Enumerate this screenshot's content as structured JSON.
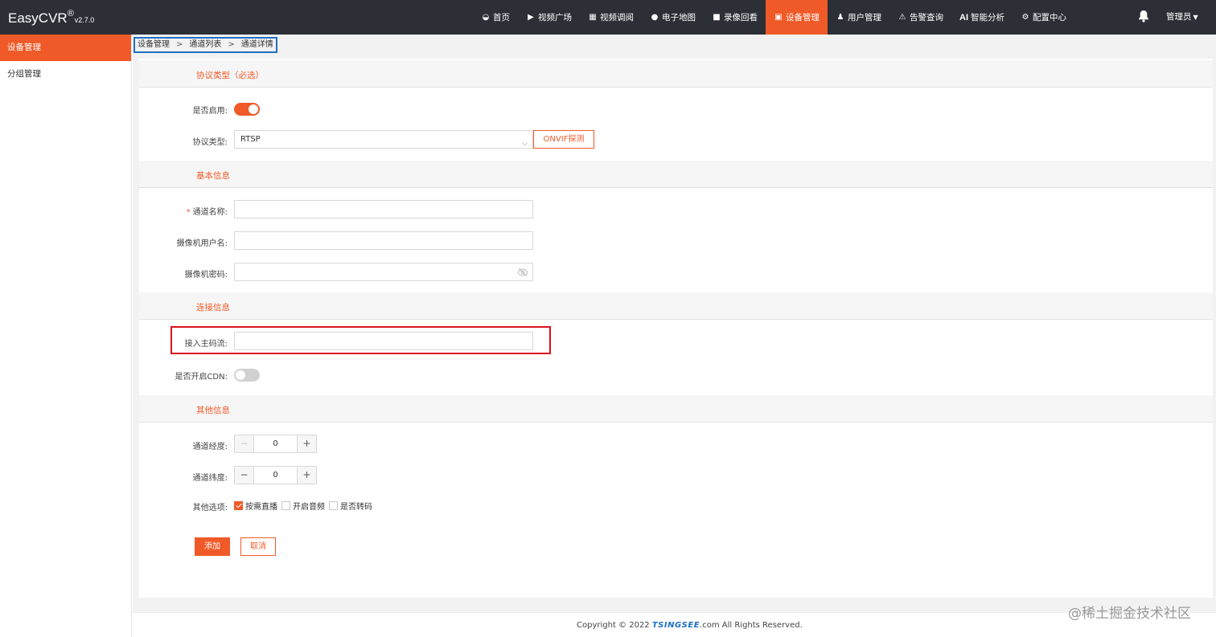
{
  "app": {
    "name": "EasyCVR",
    "reg": "®",
    "version": "v2.7.0"
  },
  "nav": [
    {
      "icon": "dashboard-icon",
      "glyph": "◒",
      "label": "首页"
    },
    {
      "icon": "play-icon",
      "glyph": "▶",
      "label": "视频广场"
    },
    {
      "icon": "grid-icon",
      "glyph": "▦",
      "label": "视频调阅"
    },
    {
      "icon": "map-pin-icon",
      "glyph": "●",
      "label": "电子地图"
    },
    {
      "icon": "video-camera-icon",
      "glyph": "■",
      "label": "录像回看"
    },
    {
      "icon": "device-icon",
      "glyph": "▣",
      "label": "设备管理",
      "active": true
    },
    {
      "icon": "user-icon",
      "glyph": "♟",
      "label": "用户管理"
    },
    {
      "icon": "alarm-icon",
      "glyph": "⚠",
      "label": "告警查询"
    },
    {
      "icon": "ai-icon",
      "glyph": "AI",
      "label": "智能分析"
    },
    {
      "icon": "gear-icon",
      "glyph": "⚙",
      "label": "配置中心"
    }
  ],
  "user": {
    "name": "管理员",
    "caret": "▼"
  },
  "sidebar": {
    "items": [
      {
        "label": "设备管理",
        "active": true
      },
      {
        "label": "分组管理"
      }
    ]
  },
  "breadcrumb": {
    "items": [
      "设备管理",
      "通道列表",
      "通道详情"
    ],
    "separator": ">"
  },
  "sections": {
    "protocol": "协议类型（必选）",
    "basic": "基本信息",
    "connection": "连接信息",
    "other": "其他信息"
  },
  "form": {
    "enable_label": "是否启用:",
    "enable_on": true,
    "protocol_label": "协议类型:",
    "protocol_value": "RTSP",
    "onvif_button": "ONVIF探测",
    "channel_name_label": "通道名称:",
    "required_mark": "*",
    "camera_user_label": "摄像机用户名:",
    "camera_password_label": "摄像机密码:",
    "main_stream_label": "接入主码流:",
    "cdn_label": "是否开启CDN:",
    "cdn_on": false,
    "longitude_label": "通道经度:",
    "longitude_value": "0",
    "latitude_label": "通道纬度:",
    "latitude_value": "0",
    "options_label": "其他选项:",
    "options": [
      {
        "label": "按需直播",
        "checked": true
      },
      {
        "label": "开启音频",
        "checked": false
      },
      {
        "label": "是否转码",
        "checked": false
      }
    ],
    "minus": "−",
    "plus": "+",
    "add_button": "添加",
    "cancel_button": "取消"
  },
  "footer": {
    "prefix": "Copyright © 2022 ",
    "brand": "TSINGSEE",
    "suffix": ".com All Rights Reserved."
  },
  "watermark": "@稀土掘金技术社区",
  "colors": {
    "accent": "#f05a28",
    "topbar": "#2c2f36",
    "highlight_red": "#d9121b",
    "highlight_blue": "#1e6fc4"
  }
}
